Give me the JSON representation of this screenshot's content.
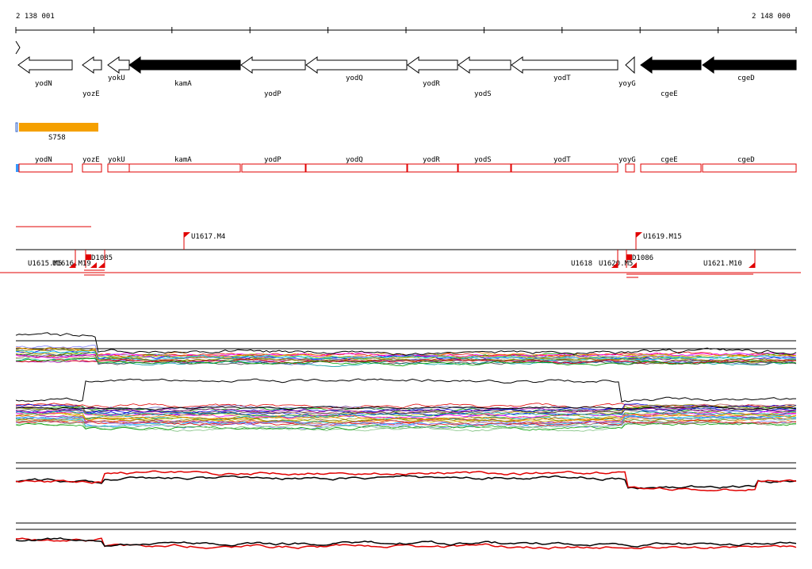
{
  "ruler": {
    "start_label": "2 138 001",
    "end_label": "2 148 000"
  },
  "genes": [
    {
      "name": "yodN",
      "strand": "-",
      "filled": false
    },
    {
      "name": "yozE",
      "strand": "-",
      "filled": false
    },
    {
      "name": "yokU",
      "strand": "-",
      "filled": false
    },
    {
      "name": "kamA",
      "strand": "-",
      "filled": true
    },
    {
      "name": "yodP",
      "strand": "-",
      "filled": false
    },
    {
      "name": "yodQ",
      "strand": "-",
      "filled": false
    },
    {
      "name": "yodR",
      "strand": "-",
      "filled": false
    },
    {
      "name": "yodS",
      "strand": "-",
      "filled": false
    },
    {
      "name": "yodT",
      "strand": "-",
      "filled": false
    },
    {
      "name": "yoyG",
      "strand": "-",
      "filled": false
    },
    {
      "name": "cgeE",
      "strand": "-",
      "filled": true
    },
    {
      "name": "cgeD",
      "strand": "-",
      "filled": true
    }
  ],
  "segment": {
    "label": "S758",
    "color": "#f5a000"
  },
  "annotation_boxes": [
    "yodN",
    "yozE",
    "yokU",
    "kamA",
    "yodP",
    "yodQ",
    "yodR",
    "yodS",
    "yodT",
    "yoyG",
    "cgeE",
    "cgeD"
  ],
  "transcript_upshifts": [
    {
      "label": "U1615.M5"
    },
    {
      "label": "U1616.M19"
    },
    {
      "label": "D1085"
    },
    {
      "label": "U1617.M4"
    },
    {
      "label": "U1618"
    },
    {
      "label": "U1620.M5"
    },
    {
      "label": "U1619.M15"
    },
    {
      "label": "D1086"
    },
    {
      "label": "U1621.M10"
    }
  ],
  "colors": {
    "gene_outline": "#000000",
    "annotation_box": "#e00000",
    "marker_flag": "#e00000",
    "segment_bar": "#f5a000",
    "track_red": "#e00000",
    "track_black": "#000000"
  }
}
